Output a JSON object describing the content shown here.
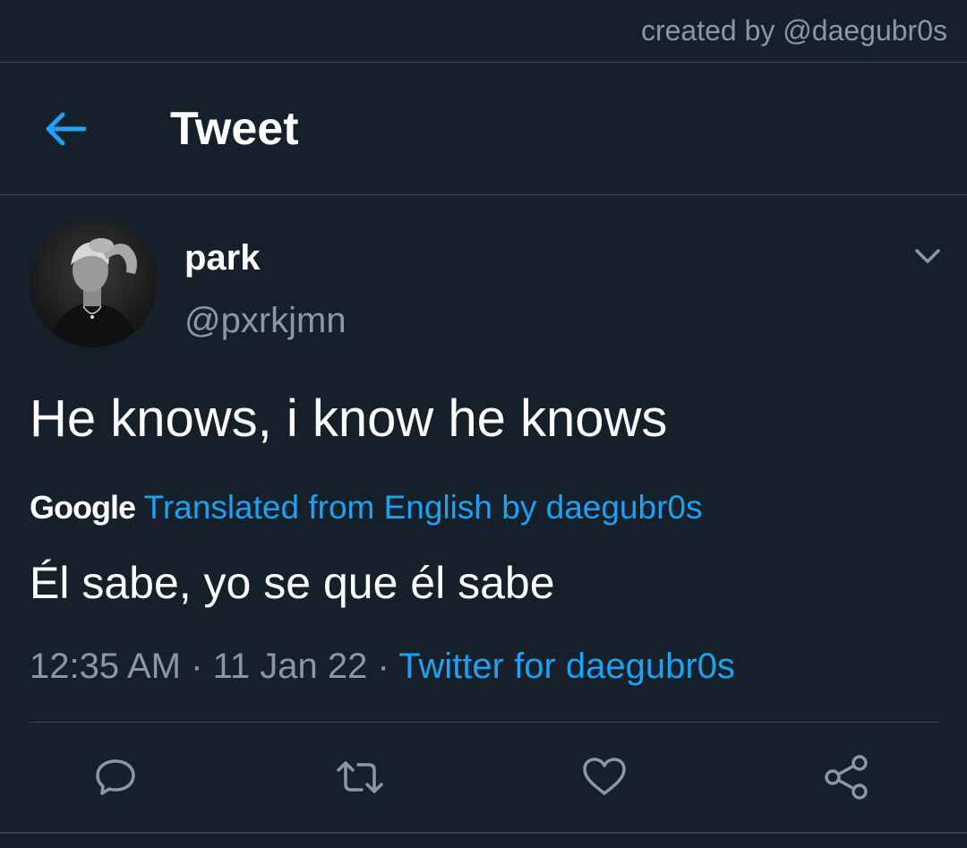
{
  "credit": {
    "text": "created by @daegubr0s"
  },
  "header": {
    "title": "Tweet",
    "back_icon": "arrow-left-icon"
  },
  "tweet": {
    "author": {
      "name": "park",
      "handle": "@pxrkjmn"
    },
    "text": "He knows, i know he knows",
    "translation": {
      "provider": "Google",
      "label": "Translated from English by daegubr0s",
      "text": "Él sabe, yo se que él sabe"
    },
    "meta": {
      "time": "12:35 AM",
      "separator": "·",
      "date": "11 Jan 22",
      "source": "Twitter for daegubr0s"
    }
  },
  "actions": [
    {
      "icon": "reply-icon"
    },
    {
      "icon": "retweet-icon"
    },
    {
      "icon": "like-icon"
    },
    {
      "icon": "share-icon"
    }
  ],
  "colors": {
    "background": "#15202b",
    "accent": "#1da1f2",
    "muted": "#8899a6",
    "border": "#38444d"
  }
}
